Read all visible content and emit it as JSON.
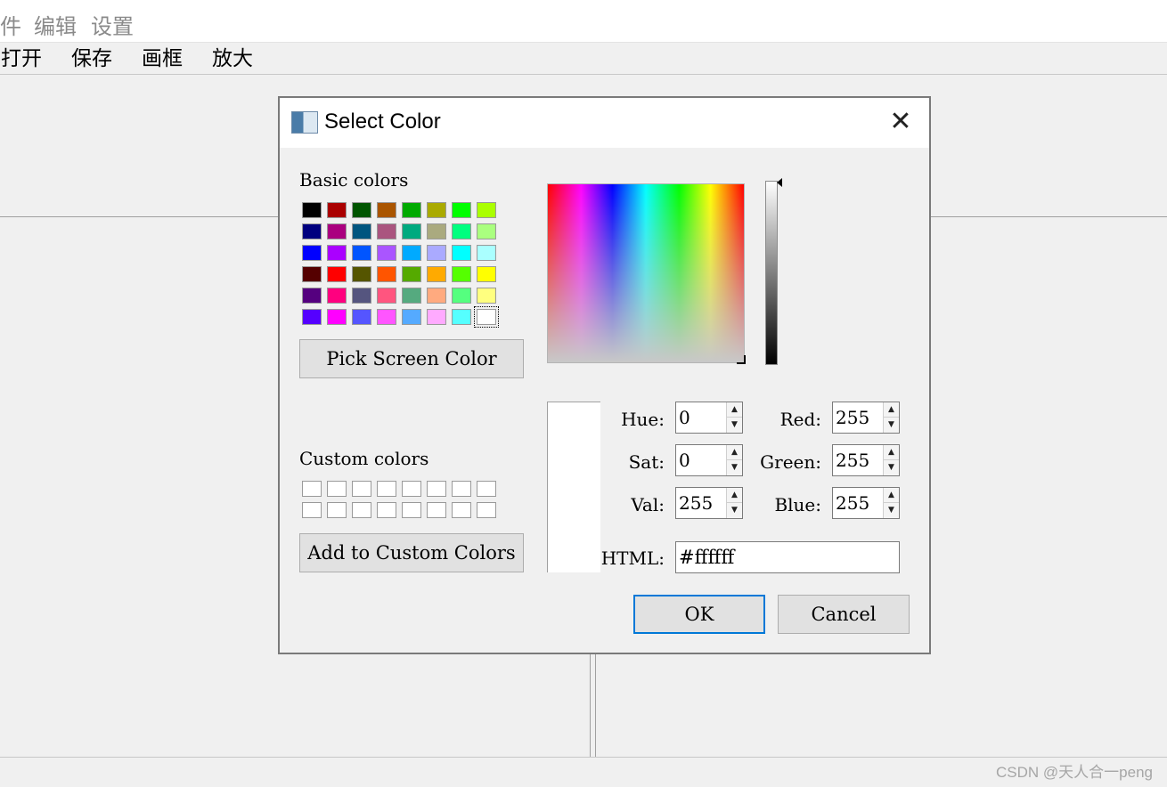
{
  "app": {
    "menu": [
      "件",
      "编辑",
      "设置"
    ],
    "toolbar": [
      "打开",
      "保存",
      "画框",
      "放大"
    ],
    "watermark": "CSDN @天人合一peng"
  },
  "dialog": {
    "title": "Select Color",
    "close_icon": "close-icon",
    "basic_colors_label": "Basic colors",
    "basic_colors": [
      [
        "#000000",
        "#aa0000",
        "#005500",
        "#aa5500",
        "#00aa00",
        "#aaaa00",
        "#00ff00",
        "#aaff00"
      ],
      [
        "#00007f",
        "#aa007f",
        "#00557f",
        "#aa557f",
        "#00aa7f",
        "#aaaa7f",
        "#00ff7f",
        "#aaff7f"
      ],
      [
        "#0000ff",
        "#aa00ff",
        "#0055ff",
        "#aa55ff",
        "#00aaff",
        "#aaaaff",
        "#00ffff",
        "#aaffff"
      ],
      [
        "#550000",
        "#ff0000",
        "#555500",
        "#ff5500",
        "#55aa00",
        "#ffaa00",
        "#55ff00",
        "#ffff00"
      ],
      [
        "#55007f",
        "#ff007f",
        "#55557f",
        "#ff557f",
        "#55aa7f",
        "#ffaa7f",
        "#55ff7f",
        "#ffff7f"
      ],
      [
        "#5500ff",
        "#ff00ff",
        "#5555ff",
        "#ff55ff",
        "#55aaff",
        "#ffaaff",
        "#55ffff",
        "#ffffff"
      ]
    ],
    "pick_screen_color": "Pick Screen Color",
    "custom_colors_label": "Custom colors",
    "custom_colors": [
      [
        "#ffffff",
        "#ffffff",
        "#ffffff",
        "#ffffff",
        "#ffffff",
        "#ffffff",
        "#ffffff",
        "#ffffff"
      ],
      [
        "#ffffff",
        "#ffffff",
        "#ffffff",
        "#ffffff",
        "#ffffff",
        "#ffffff",
        "#ffffff",
        "#ffffff"
      ]
    ],
    "add_custom": "Add to Custom Colors",
    "current_color": "#ffffff",
    "fields": {
      "hue": {
        "label": "Hue:",
        "value": "0"
      },
      "sat": {
        "label": "Sat:",
        "value": "0"
      },
      "val": {
        "label": "Val:",
        "value": "255"
      },
      "red": {
        "label": "Red:",
        "value": "255"
      },
      "green": {
        "label": "Green:",
        "value": "255"
      },
      "blue": {
        "label": "Blue:",
        "value": "255"
      },
      "html": {
        "label": "HTML:",
        "value": "#ffffff"
      }
    },
    "ok": "OK",
    "cancel": "Cancel"
  }
}
